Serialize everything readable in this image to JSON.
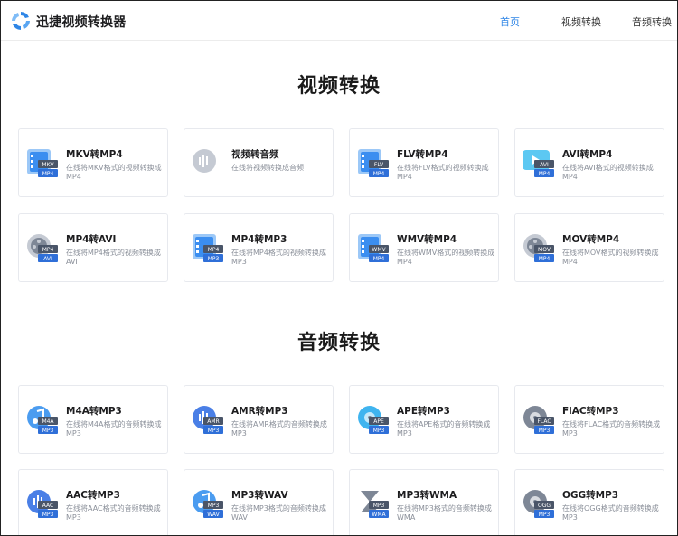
{
  "header": {
    "brand": "迅捷视频转换器",
    "nav": [
      "首页",
      "视频转换",
      "音频转换"
    ],
    "active_color": "#2f86e6"
  },
  "sections": [
    {
      "title": "视频转换",
      "cards": [
        {
          "title": "MKV转MP4",
          "desc": "在线将MKV格式的视频转换成MP4",
          "icon": "film-convert-icon",
          "badge_top": "MKV",
          "badge_bottom": "MP4"
        },
        {
          "title": "视频转音频",
          "desc": "在线将视频转换成音频",
          "icon": "soundwave-icon"
        },
        {
          "title": "FLV转MP4",
          "desc": "在线将FLV格式的视频转换成MP4",
          "icon": "film-convert-icon",
          "badge_top": "FLV",
          "badge_bottom": "MP4"
        },
        {
          "title": "AVI转MP4",
          "desc": "在线将AVI格式的视频转换成MP4",
          "icon": "play-screen-icon",
          "badge_top": "AVI",
          "badge_bottom": "MP4"
        },
        {
          "title": "MP4转AVI",
          "desc": "在线将MP4格式的视频转换成AVI",
          "icon": "film-reel-icon",
          "badge_top": "MP4",
          "badge_bottom": "AVI"
        },
        {
          "title": "MP4转MP3",
          "desc": "在线将MP4格式的视频转换成MP3",
          "icon": "film-convert-icon",
          "badge_top": "MP4",
          "badge_bottom": "MP3"
        },
        {
          "title": "WMV转MP4",
          "desc": "在线将WMV格式的视频转换成MP4",
          "icon": "film-convert-icon",
          "badge_top": "WMV",
          "badge_bottom": "MP4"
        },
        {
          "title": "MOV转MP4",
          "desc": "在线将MOV格式的视频转换成MP4",
          "icon": "film-reel-icon",
          "badge_top": "MOV",
          "badge_bottom": "MP4"
        }
      ]
    },
    {
      "title": "音频转换",
      "cards": [
        {
          "title": "M4A转MP3",
          "desc": "在线将M4A格式的音频转换成MP3",
          "icon": "music-note-icon",
          "badge_top": "M4A",
          "badge_bottom": "MP3"
        },
        {
          "title": "AMR转MP3",
          "desc": "在线将AMR格式的音频转换成MP3",
          "icon": "soundwave-icon",
          "badge_top": "AMR",
          "badge_bottom": "MP3"
        },
        {
          "title": "APE转MP3",
          "desc": "在线将APE格式的音频转换成MP3",
          "icon": "disc-icon",
          "badge_top": "APE",
          "badge_bottom": "MP3"
        },
        {
          "title": "FlAC转MP3",
          "desc": "在线将FLAC格式的音频转换成MP3",
          "icon": "disc-icon",
          "badge_top": "FLAC",
          "badge_bottom": "MP3"
        },
        {
          "title": "AAC转MP3",
          "desc": "在线将AAC格式的音频转换成MP3",
          "icon": "soundwave-icon",
          "badge_top": "AAC",
          "badge_bottom": "MP3"
        },
        {
          "title": "MP3转WAV",
          "desc": "在线将MP3格式的音频转换成WAV",
          "icon": "music-note-icon",
          "badge_top": "MP3",
          "badge_bottom": "WAV"
        },
        {
          "title": "MP3转WMA",
          "desc": "在线将MP3格式的音频转换成WMA",
          "icon": "hourglass-icon",
          "badge_top": "MP3",
          "badge_bottom": "WMA"
        },
        {
          "title": "OGG转MP3",
          "desc": "在线将OGG格式的音频转换成MP3",
          "icon": "disc-icon",
          "badge_top": "OGG",
          "badge_bottom": "MP3"
        }
      ]
    }
  ]
}
